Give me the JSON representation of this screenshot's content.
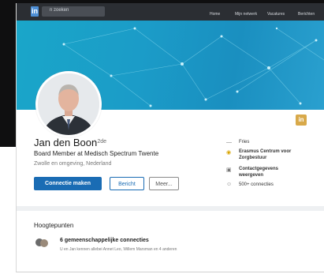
{
  "nav": {
    "logo": "in",
    "search_placeholder": "n zoeken",
    "items": [
      "Home",
      "Mijn netwerk",
      "Vacatures",
      "Berichten"
    ]
  },
  "profile": {
    "name": "Jan den Boon",
    "degree": "• 2de",
    "headline": "Board Member at Medisch Spectrum Twente",
    "location": "Zwolle en omgeving, Nederland",
    "buttons": {
      "connect": "Connectie maken",
      "message": "Bericht",
      "more": "Meer..."
    }
  },
  "sidebar": {
    "item1": "Fries",
    "item2_line1": "Erasmus Centrum voor",
    "item2_line2": "Zorgbestuur",
    "item3_line1": "Contactgegevens",
    "item3_line2": "weergeven",
    "item4": "500+ connecties"
  },
  "highlights": {
    "title": "Hoogtepunten",
    "connections_title": "6 gemeenschappelijke connecties",
    "connections_sub": "U en Jan kennen allebei Annet Leo, Willem Marsman en 4 anderen"
  },
  "badge": "in",
  "colors": {
    "primary": "#1a6cb4",
    "banner": "#1b9cc8",
    "nav": "#2b2e33"
  }
}
